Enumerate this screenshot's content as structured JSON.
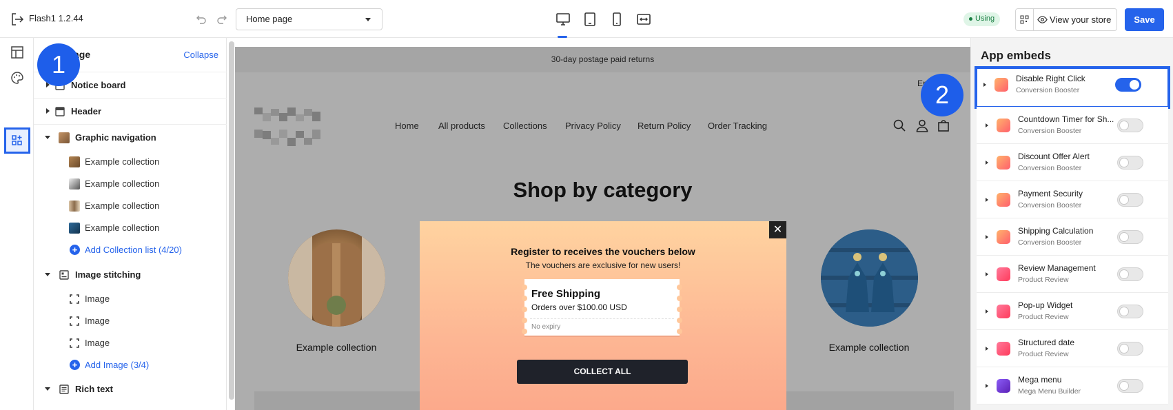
{
  "topbar": {
    "app_title": "Flash1 1.2.44",
    "page_select": "Home page",
    "using_label": "Using",
    "view_store": "View your store",
    "save": "Save"
  },
  "left_panel": {
    "title": "Home page",
    "title_visible": "age",
    "collapse": "Collapse",
    "items": [
      {
        "label": "Notice board"
      },
      {
        "label": "Header"
      },
      {
        "label": "Graphic navigation"
      },
      {
        "label": "Example collection"
      },
      {
        "label": "Example collection"
      },
      {
        "label": "Example collection"
      },
      {
        "label": "Example collection"
      },
      {
        "label": "Add Collection list (4/20)"
      },
      {
        "label": "Image stitching"
      },
      {
        "label": "Image"
      },
      {
        "label": "Image"
      },
      {
        "label": "Image"
      },
      {
        "label": "Add Image (3/4)"
      },
      {
        "label": "Rich text"
      }
    ]
  },
  "preview": {
    "notice": "30-day postage paid returns",
    "lang": "En",
    "nav": [
      "Home",
      "All products",
      "Collections",
      "Privacy Policy",
      "Return Policy",
      "Order Tracking"
    ],
    "section_title": "Shop by category",
    "collection_left": "Example collection",
    "collection_right": "Example collection"
  },
  "popup": {
    "close": "✕",
    "title": "Register to receives the vouchers below",
    "subtitle": "The vouchers are exclusive for new users!",
    "voucher_title": "Free Shipping",
    "voucher_desc": "Orders over $100.00 USD",
    "voucher_expiry": "No expiry",
    "collect": "COLLECT ALL"
  },
  "app_embeds": {
    "title": "App embeds",
    "items": [
      {
        "name": "Disable Right Click",
        "provider": "Conversion Booster",
        "enabled": true
      },
      {
        "name": "Countdown Timer for Sh...",
        "provider": "Conversion Booster",
        "enabled": false
      },
      {
        "name": "Discount Offer Alert",
        "provider": "Conversion Booster",
        "enabled": false
      },
      {
        "name": "Payment Security",
        "provider": "Conversion Booster",
        "enabled": false
      },
      {
        "name": "Shipping Calculation",
        "provider": "Conversion Booster",
        "enabled": false
      },
      {
        "name": "Review Management",
        "provider": "Product Review",
        "enabled": false
      },
      {
        "name": "Pop-up Widget",
        "provider": "Product Review",
        "enabled": false
      },
      {
        "name": "Structured date",
        "provider": "Product Review",
        "enabled": false
      },
      {
        "name": "Mega menu",
        "provider": "Mega Menu Builder",
        "enabled": false
      }
    ]
  },
  "annotations": {
    "one": "1",
    "two": "2"
  },
  "colors": {
    "accent": "#2563eb",
    "using_bg": "#dff5e7",
    "preview_bg": "#adadad"
  }
}
